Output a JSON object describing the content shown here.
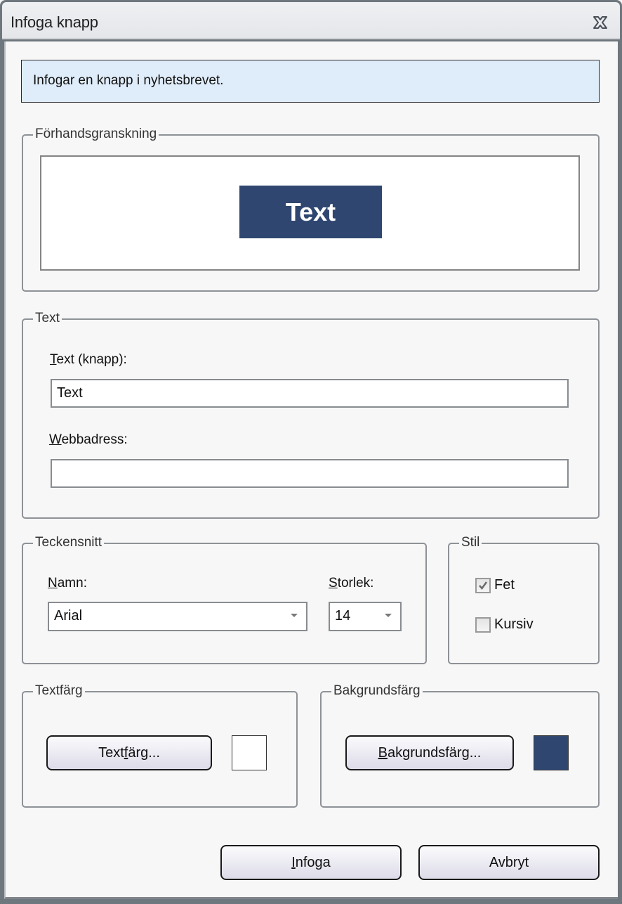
{
  "window": {
    "title": "Infoga knapp",
    "close_icon": "close-x-icon"
  },
  "info": {
    "text": "Infogar en knapp i nyhetsbrevet."
  },
  "preview": {
    "legend": "Förhandsgranskning",
    "button_text": "Text",
    "button_bg_color": "#2f4770",
    "button_text_color": "#ffffff"
  },
  "text_group": {
    "legend": "Text",
    "button_text_label_accel": "T",
    "button_text_label_rest": "ext (knapp):",
    "button_text_value": "Text",
    "url_label_accel": "W",
    "url_label_rest": "ebbadress:",
    "url_value": ""
  },
  "font_group": {
    "legend": "Teckensnitt",
    "name_label_accel": "N",
    "name_label_rest": "amn:",
    "name_value": "Arial",
    "size_label_accel": "S",
    "size_label_rest": "torlek:",
    "size_value": "14"
  },
  "style_group": {
    "legend": "Stil",
    "bold_label": "Fet",
    "bold_checked": true,
    "italic_label": "Kursiv",
    "italic_checked": false
  },
  "text_color_group": {
    "legend": "Textfärg",
    "button_pre": "Text",
    "button_accel": "f",
    "button_post": "ärg...",
    "swatch_color": "#ffffff"
  },
  "bg_color_group": {
    "legend": "Bakgrundsfärg",
    "button_accel": "B",
    "button_post": "akgrundsfärg...",
    "swatch_color": "#2f4770"
  },
  "footer": {
    "insert_accel": "I",
    "insert_rest": "nfoga",
    "cancel_label": "Avbryt"
  }
}
